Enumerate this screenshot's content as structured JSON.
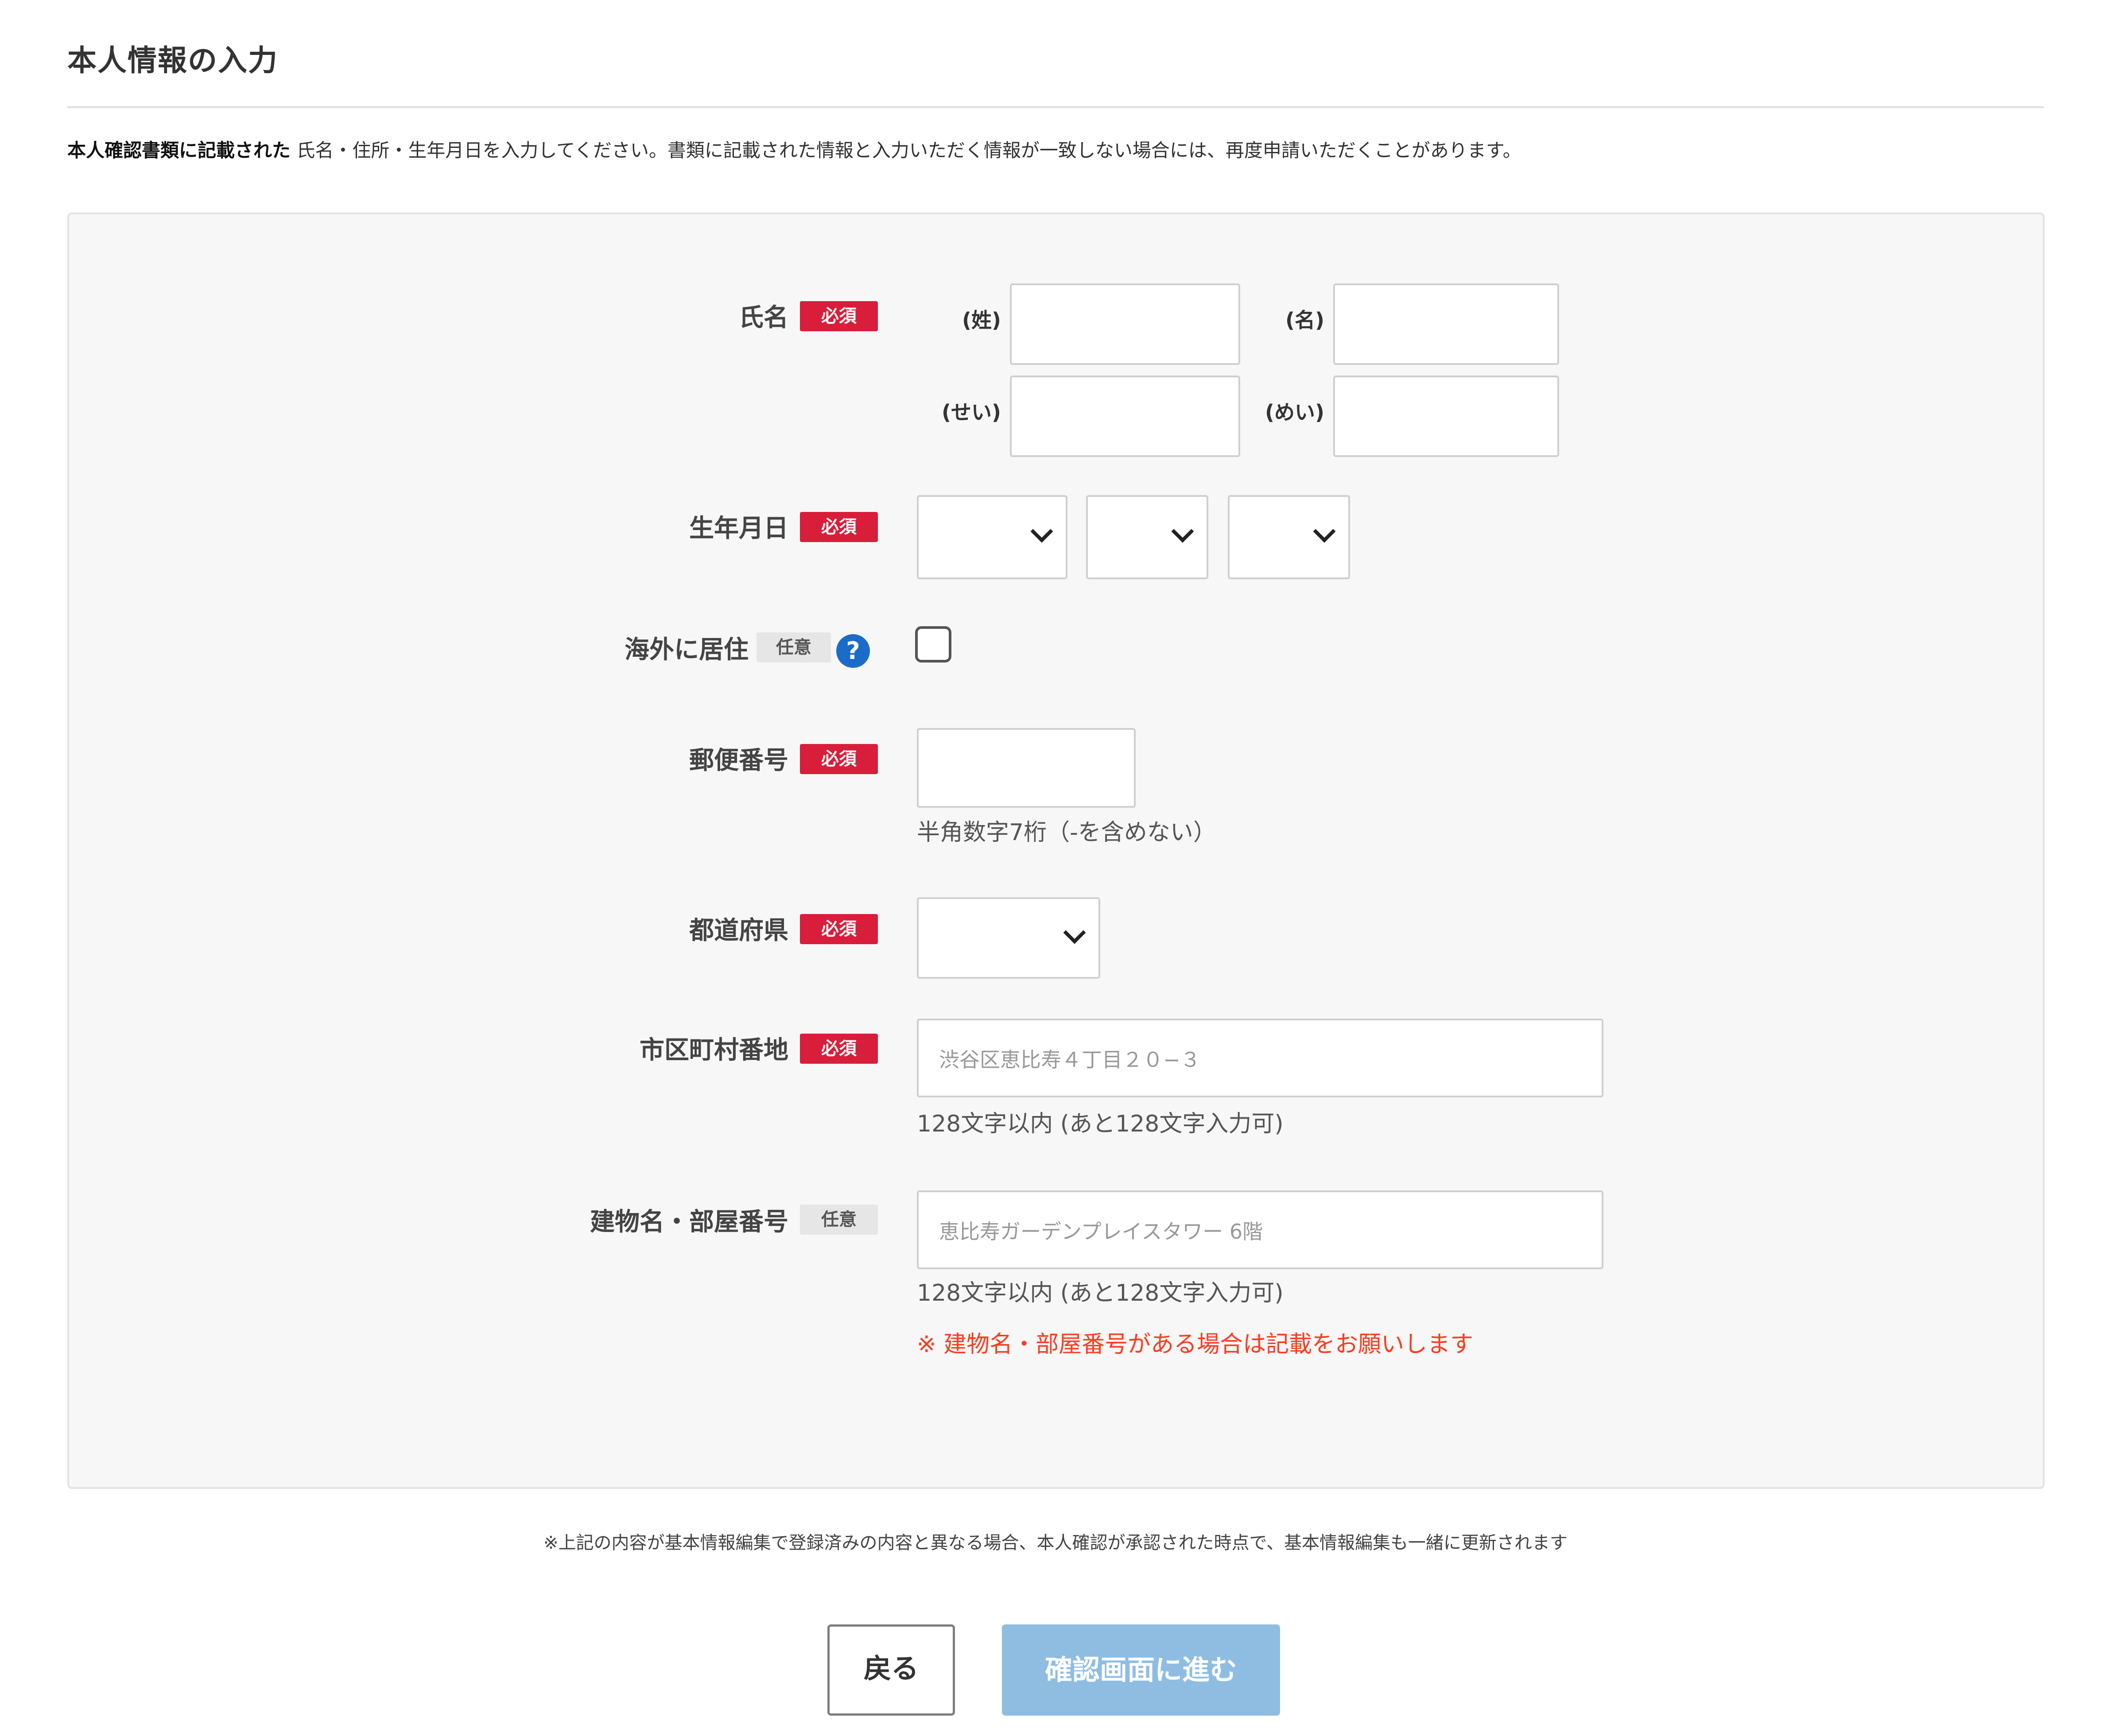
{
  "header": {
    "title": "本人情報の入力"
  },
  "intro": {
    "bold": "本人確認書類に記載された",
    "text": " 氏名・住所・生年月日を入力してください。書類に記載された情報と入力いただく情報が一致しない場合には、再度申請いただくことがあります。"
  },
  "badges": {
    "required": "必須",
    "optional": "任意"
  },
  "form": {
    "name": {
      "label": "氏名",
      "last_label": "(姓)",
      "first_label": "(名)",
      "last_kana_label": "(せい)",
      "first_kana_label": "(めい)"
    },
    "birthdate": {
      "label": "生年月日"
    },
    "overseas": {
      "label": "海外に居住",
      "help_icon": "question-icon"
    },
    "postal": {
      "label": "郵便番号",
      "hint": "半角数字7桁（-を含めない）"
    },
    "prefecture": {
      "label": "都道府県"
    },
    "city": {
      "label": "市区町村番地",
      "placeholder": "渋谷区恵比寿４丁目２０−３",
      "hint": "128文字以内 (あと128文字入力可)"
    },
    "building": {
      "label": "建物名・部屋番号",
      "placeholder": "恵比寿ガーデンプレイスタワー 6階",
      "hint": "128文字以内 (あと128文字入力可)",
      "warning": "※ 建物名・部屋番号がある場合は記載をお願いします"
    }
  },
  "footer_note": "※上記の内容が基本情報編集で登録済みの内容と異なる場合、本人確認が承認された時点で、基本情報編集も一緒に更新されます",
  "buttons": {
    "back": "戻る",
    "next": "確認画面に進む"
  },
  "colors": {
    "required_badge": "#d81e3a",
    "help_icon": "#1b6cc8",
    "warning_text": "#ff3b1f",
    "next_button": "#8fbde2"
  }
}
